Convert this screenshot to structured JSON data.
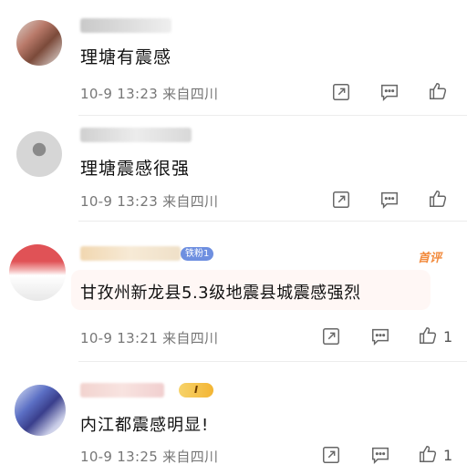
{
  "comments": [
    {
      "text": "理塘有震感",
      "meta": "10-9 13:23  来自四川",
      "like_count": ""
    },
    {
      "text": "理塘震感很强",
      "meta": "10-9 13:23  来自四川",
      "like_count": ""
    },
    {
      "badge": "铁粉1",
      "tag": "首评",
      "text": "甘孜州新龙县5.3级地震县城震感强烈",
      "meta": "10-9 13:21  来自四川",
      "like_count": "1"
    },
    {
      "level": "I",
      "text": "内江都震感明显!",
      "meta": "10-9 13:25  来自四川",
      "like_count": "1"
    }
  ],
  "icons": {
    "share": "share-icon",
    "comment": "comment-icon",
    "like": "thumbs-up-icon"
  },
  "colors": {
    "accent_tag": "#f28a3c",
    "fan_badge": "#6e8fe0",
    "highlight_bg": "#fff7f5"
  }
}
